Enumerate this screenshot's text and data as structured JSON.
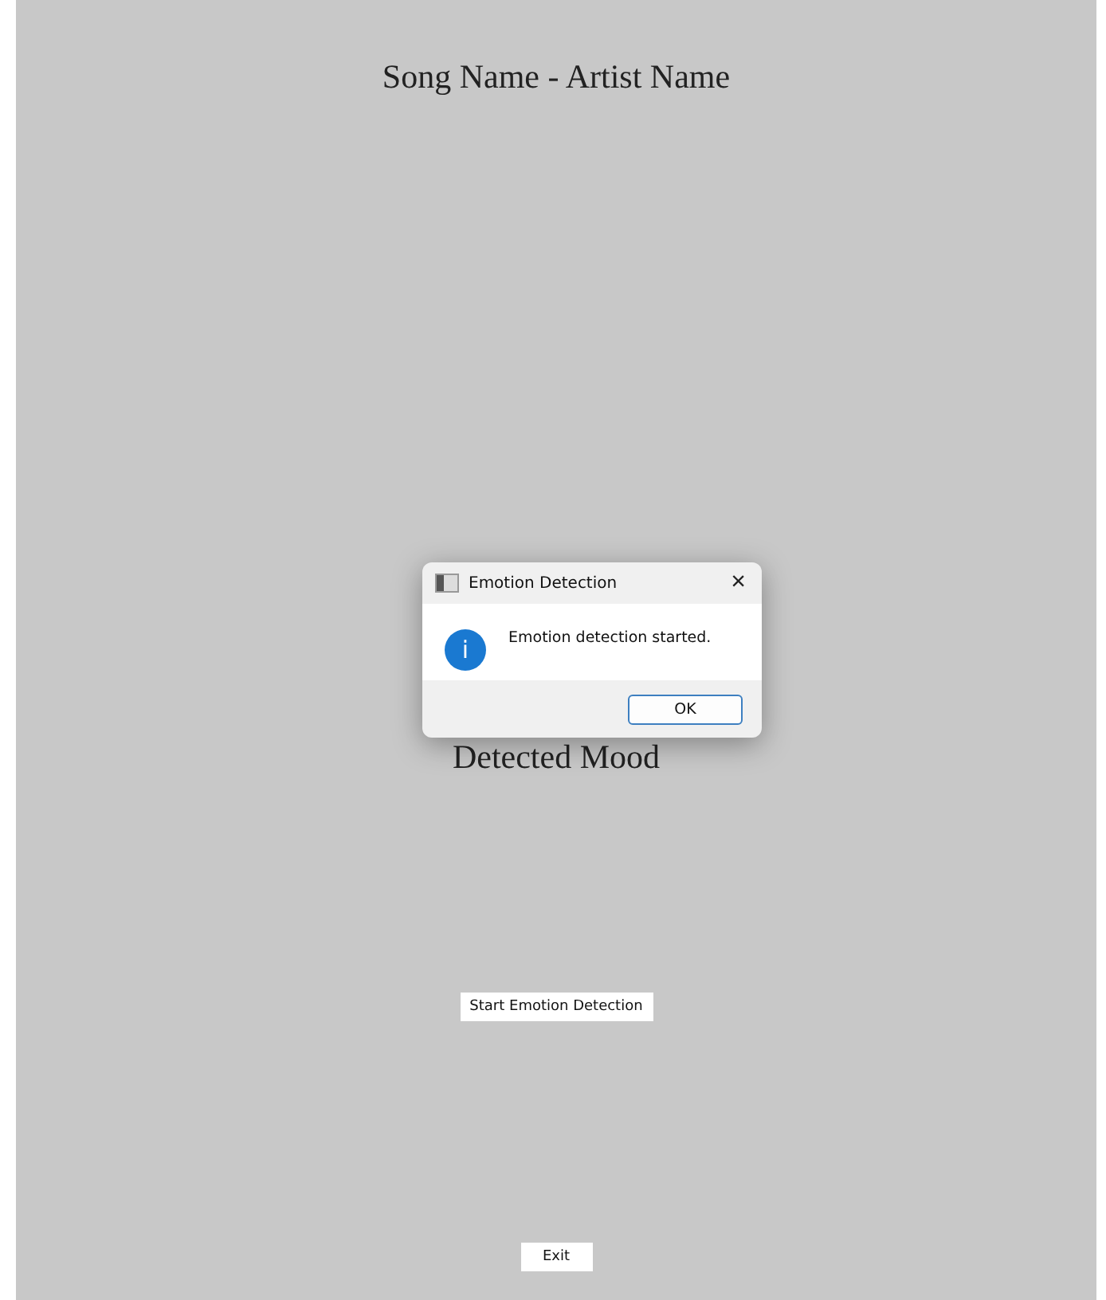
{
  "song_title": "Song Name - Artist Name",
  "mood_label": "Detected Mood",
  "start_button": "Start Emotion Detection",
  "exit_button": "Exit",
  "dialog": {
    "title": "Emotion Detection",
    "close": "×",
    "message": "Emotion detection started.",
    "icon": "i",
    "ok_button": "OK"
  }
}
